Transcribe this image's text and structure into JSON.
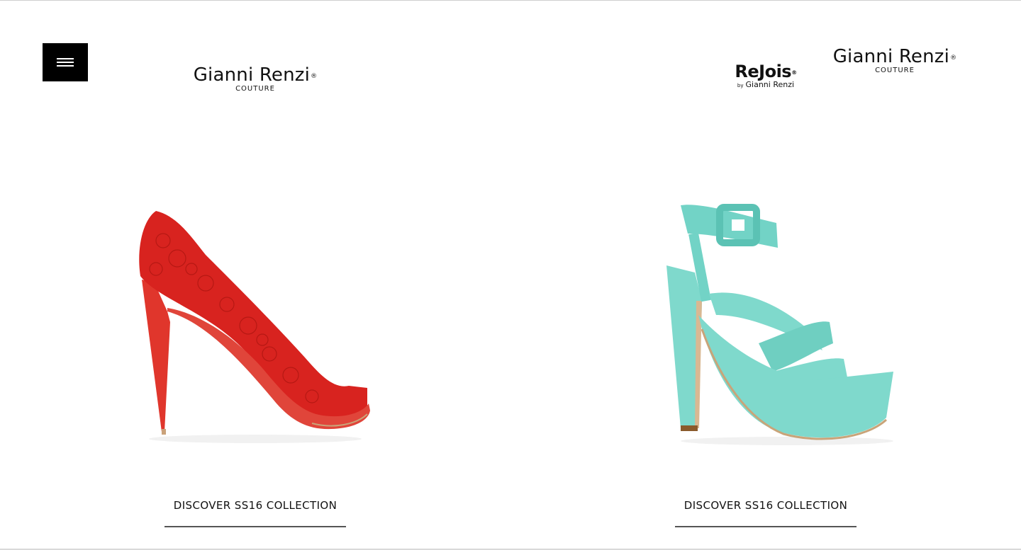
{
  "nav": {
    "menu_icon": "hamburger-icon"
  },
  "brands": {
    "gianni_renzi": {
      "name": "Gianni Renzi",
      "mark": "®",
      "sub": "COUTURE"
    },
    "rejois": {
      "name": "ReJois",
      "mark": "®",
      "by": "by",
      "by_name": "Gianni Renzi"
    }
  },
  "panels": [
    {
      "product": "red lace peep-toe stiletto pump",
      "color": "#d8231f",
      "cta": "DISCOVER SS16 COLLECTION"
    },
    {
      "product": "turquoise patent platform sandal",
      "color": "#7fd9cc",
      "cta": "DISCOVER SS16 COLLECTION"
    }
  ]
}
